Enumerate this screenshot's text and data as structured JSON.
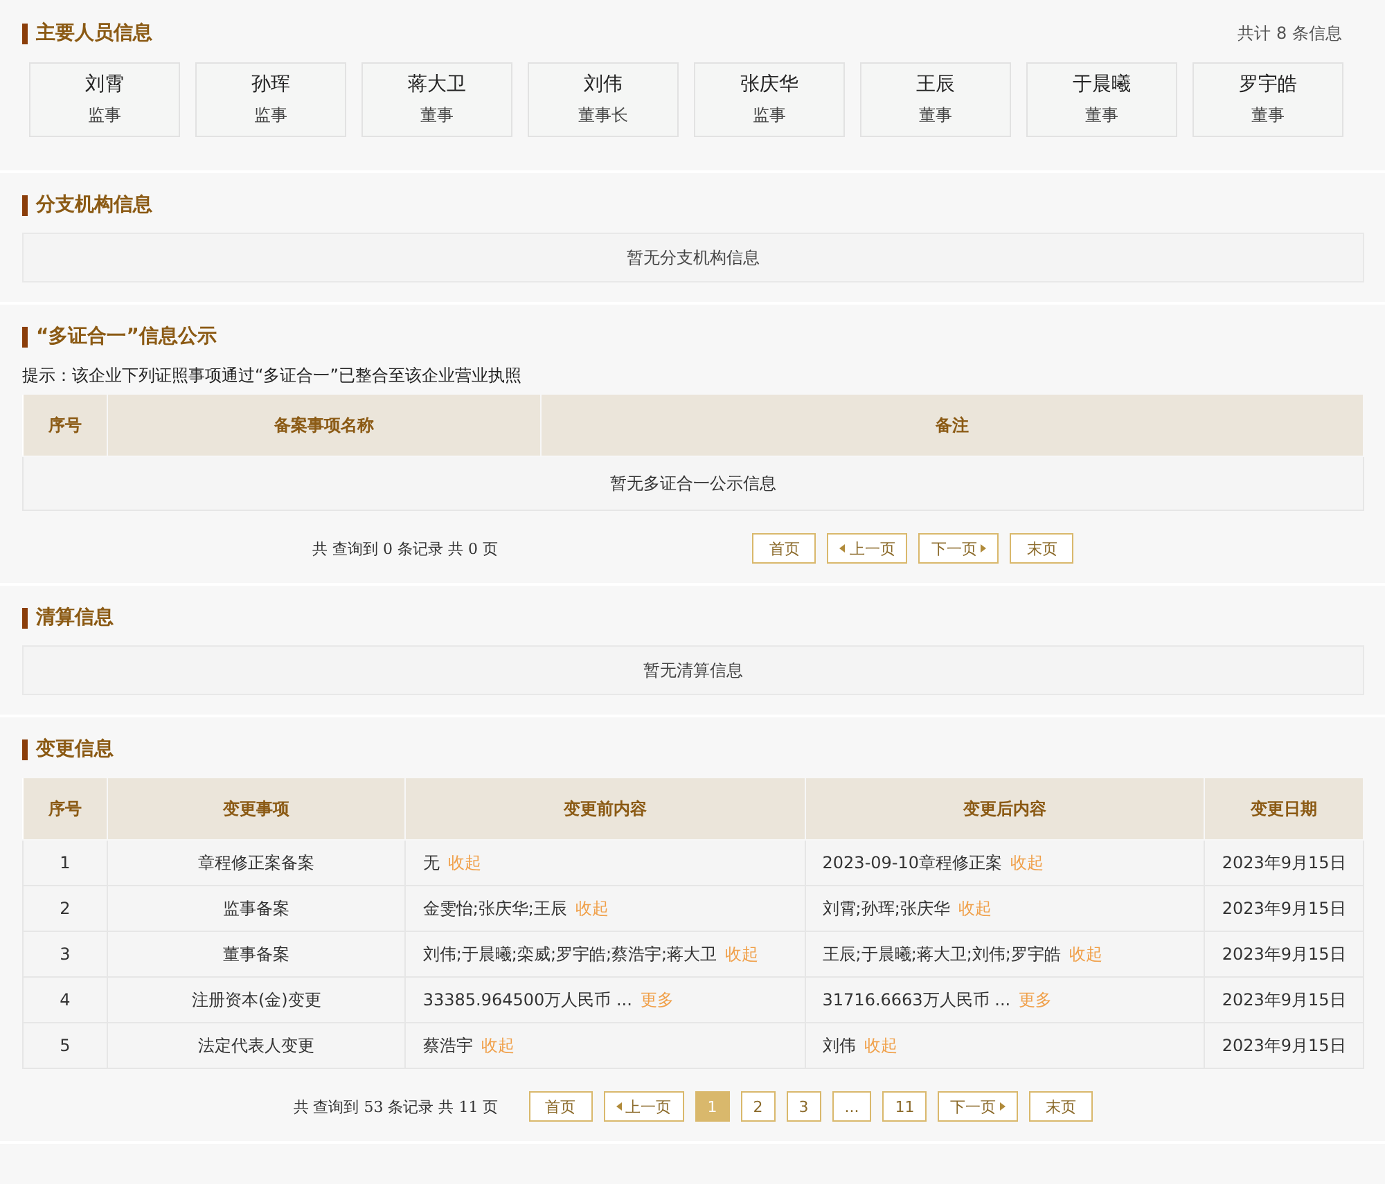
{
  "personnel": {
    "title": "主要人员信息",
    "count": "共计 8 条信息",
    "people": [
      {
        "name": "刘霄",
        "role": "监事"
      },
      {
        "name": "孙珲",
        "role": "监事"
      },
      {
        "name": "蒋大卫",
        "role": "董事"
      },
      {
        "name": "刘伟",
        "role": "董事长"
      },
      {
        "name": "张庆华",
        "role": "监事"
      },
      {
        "name": "王辰",
        "role": "董事"
      },
      {
        "name": "于晨曦",
        "role": "董事"
      },
      {
        "name": "罗宇皓",
        "role": "董事"
      }
    ]
  },
  "branches": {
    "title": "分支机构信息",
    "empty": "暂无分支机构信息"
  },
  "multi_cert": {
    "title": "“多证合一”信息公示",
    "hint": "提示：该企业下列证照事项通过“多证合一”已整合至该企业营业执照",
    "columns": [
      "序号",
      "备案事项名称",
      "备注"
    ],
    "empty": "暂无多证合一公示信息",
    "pager": {
      "summary": "共 查询到 0 条记录 共 0 页",
      "buttons": [
        {
          "kind": "text",
          "label": "首页"
        },
        {
          "kind": "prev",
          "label": "上一页"
        },
        {
          "kind": "next",
          "label": "下一页"
        },
        {
          "kind": "text",
          "label": "末页"
        }
      ]
    }
  },
  "liquidation": {
    "title": "清算信息",
    "empty": "暂无清算信息"
  },
  "changes": {
    "title": "变更信息",
    "columns": [
      "序号",
      "变更事项",
      "变更前内容",
      "变更后内容",
      "变更日期"
    ],
    "rows": [
      {
        "no": "1",
        "item": "章程修正案备案",
        "before": {
          "text": "无",
          "action": "收起"
        },
        "after": {
          "text": "2023-09-10章程修正案",
          "action": "收起"
        },
        "date": "2023年9月15日"
      },
      {
        "no": "2",
        "item": "监事备案",
        "before": {
          "text": "金雯怡;张庆华;王辰",
          "action": "收起"
        },
        "after": {
          "text": "刘霄;孙珲;张庆华",
          "action": "收起"
        },
        "date": "2023年9月15日"
      },
      {
        "no": "3",
        "item": "董事备案",
        "before": {
          "text": "刘伟;于晨曦;栾威;罗宇皓;蔡浩宇;蒋大卫",
          "action": "收起"
        },
        "after": {
          "text": "王辰;于晨曦;蒋大卫;刘伟;罗宇皓",
          "action": "收起"
        },
        "date": "2023年9月15日"
      },
      {
        "no": "4",
        "item": "注册资本(金)变更",
        "before": {
          "text": "33385.964500万人民币 ...",
          "action": "更多"
        },
        "after": {
          "text": "31716.6663万人民币 ...",
          "action": "更多"
        },
        "date": "2023年9月15日"
      },
      {
        "no": "5",
        "item": "法定代表人变更",
        "before": {
          "text": "蔡浩宇",
          "action": "收起"
        },
        "after": {
          "text": "刘伟",
          "action": "收起"
        },
        "date": "2023年9月15日"
      }
    ],
    "pager": {
      "summary": "共 查询到 53 条记录 共 11 页",
      "buttons": [
        {
          "kind": "text",
          "label": "首页"
        },
        {
          "kind": "prev",
          "label": "上一页"
        },
        {
          "kind": "page",
          "label": "1",
          "selected": true
        },
        {
          "kind": "page",
          "label": "2",
          "selected": false
        },
        {
          "kind": "page",
          "label": "3",
          "selected": false
        },
        {
          "kind": "page",
          "label": "...",
          "selected": false
        },
        {
          "kind": "page",
          "label": "11",
          "selected": false
        },
        {
          "kind": "next",
          "label": "下一页"
        },
        {
          "kind": "text",
          "label": "末页"
        }
      ]
    }
  }
}
